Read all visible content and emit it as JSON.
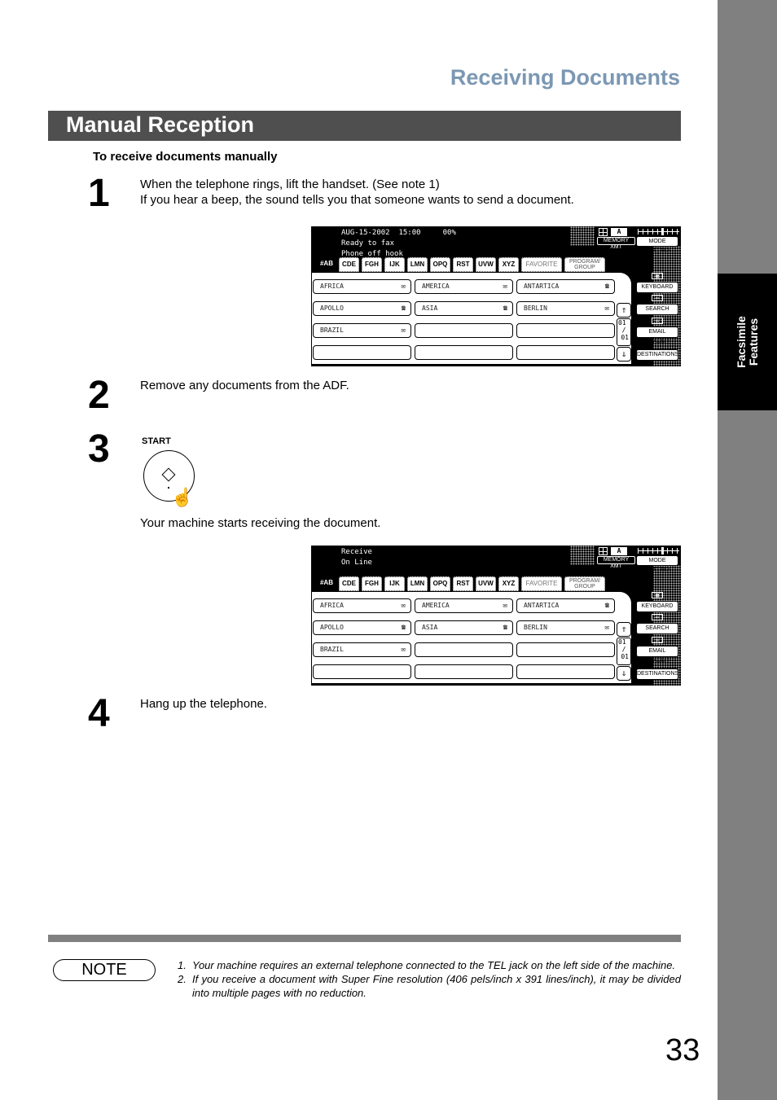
{
  "page": {
    "chapter_title": "Receiving Documents",
    "section_title": "Manual Reception",
    "subheading": "To receive documents manually",
    "side_tab_lines": [
      "Facsimile",
      "Features"
    ],
    "page_number": "33"
  },
  "steps": [
    {
      "number": "1",
      "lines": [
        "When the telephone rings, lift the handset. (See note 1)",
        "If you hear a beep, the sound tells you that someone wants to send a document."
      ]
    },
    {
      "number": "2",
      "lines": [
        "Remove any documents from the ADF."
      ]
    },
    {
      "number": "3",
      "button_label": "START",
      "lines": [
        "Your machine starts receiving the document."
      ]
    },
    {
      "number": "4",
      "lines": [
        "Hang up the telephone."
      ]
    }
  ],
  "panels": [
    {
      "status_lines": [
        "AUG-15-2002  15:00     00%",
        "Ready to fax",
        "Phone off hook"
      ],
      "memory_xmt": "MEMORY XMT",
      "mode_setting": "MODE SETTING",
      "mode_letter": "A",
      "tabs": [
        "#AB",
        "CDE",
        "FGH",
        "IJK",
        "LMN",
        "OPQ",
        "RST",
        "UVW",
        "XYZ",
        "FAVORITE",
        "PROGRAM/\nGROUP"
      ],
      "active_tab": "#AB",
      "destinations": [
        {
          "name": "AFRICA",
          "type": "email"
        },
        {
          "name": "AMERICA",
          "type": "email"
        },
        {
          "name": "ANTARTICA",
          "type": "fax"
        },
        {
          "name": "APOLLO",
          "type": "fax"
        },
        {
          "name": "ASIA",
          "type": "fax"
        },
        {
          "name": "BERLIN",
          "type": "email"
        },
        {
          "name": "BRAZIL",
          "type": "email"
        },
        {
          "name": "",
          "type": ""
        },
        {
          "name": "",
          "type": ""
        },
        {
          "name": "",
          "type": ""
        },
        {
          "name": "",
          "type": ""
        },
        {
          "name": "",
          "type": ""
        }
      ],
      "page_indicator": {
        "current": "01",
        "total": "01"
      },
      "side_buttons": [
        "KEYBOARD",
        "SEARCH",
        "EMAIL HEADER",
        "DESTINATIONS"
      ],
      "contrast_level": 0.6
    },
    {
      "status_lines": [
        "Receive",
        "On Line",
        ""
      ],
      "memory_xmt": "MEMORY XMT",
      "mode_setting": "MODE SETTING",
      "mode_letter": "A",
      "tabs": [
        "#AB",
        "CDE",
        "FGH",
        "IJK",
        "LMN",
        "OPQ",
        "RST",
        "UVW",
        "XYZ",
        "FAVORITE",
        "PROGRAM/\nGROUP"
      ],
      "active_tab": "#AB",
      "destinations": [
        {
          "name": "AFRICA",
          "type": "email"
        },
        {
          "name": "AMERICA",
          "type": "email"
        },
        {
          "name": "ANTARTICA",
          "type": "fax"
        },
        {
          "name": "APOLLO",
          "type": "fax"
        },
        {
          "name": "ASIA",
          "type": "fax"
        },
        {
          "name": "BERLIN",
          "type": "email"
        },
        {
          "name": "BRAZIL",
          "type": "email"
        },
        {
          "name": "",
          "type": ""
        },
        {
          "name": "",
          "type": ""
        },
        {
          "name": "",
          "type": ""
        },
        {
          "name": "",
          "type": ""
        },
        {
          "name": "",
          "type": ""
        }
      ],
      "page_indicator": {
        "current": "01",
        "total": "01"
      },
      "side_buttons": [
        "KEYBOARD",
        "SEARCH",
        "EMAIL HEADER",
        "DESTINATIONS"
      ],
      "contrast_level": 0.6
    }
  ],
  "icons": {
    "email": "✉",
    "fax": "☎",
    "up": "⇑",
    "down": "⇓",
    "hand": "☝"
  },
  "note": {
    "label": "NOTE",
    "items": [
      {
        "n": "1.",
        "text": "Your machine requires an external telephone connected to the TEL jack on the left side of the machine."
      },
      {
        "n": "2.",
        "text": "If you receive a document with Super Fine resolution (406 pels/inch x 391 lines/inch), it may be divided into multiple pages with no reduction."
      }
    ]
  }
}
